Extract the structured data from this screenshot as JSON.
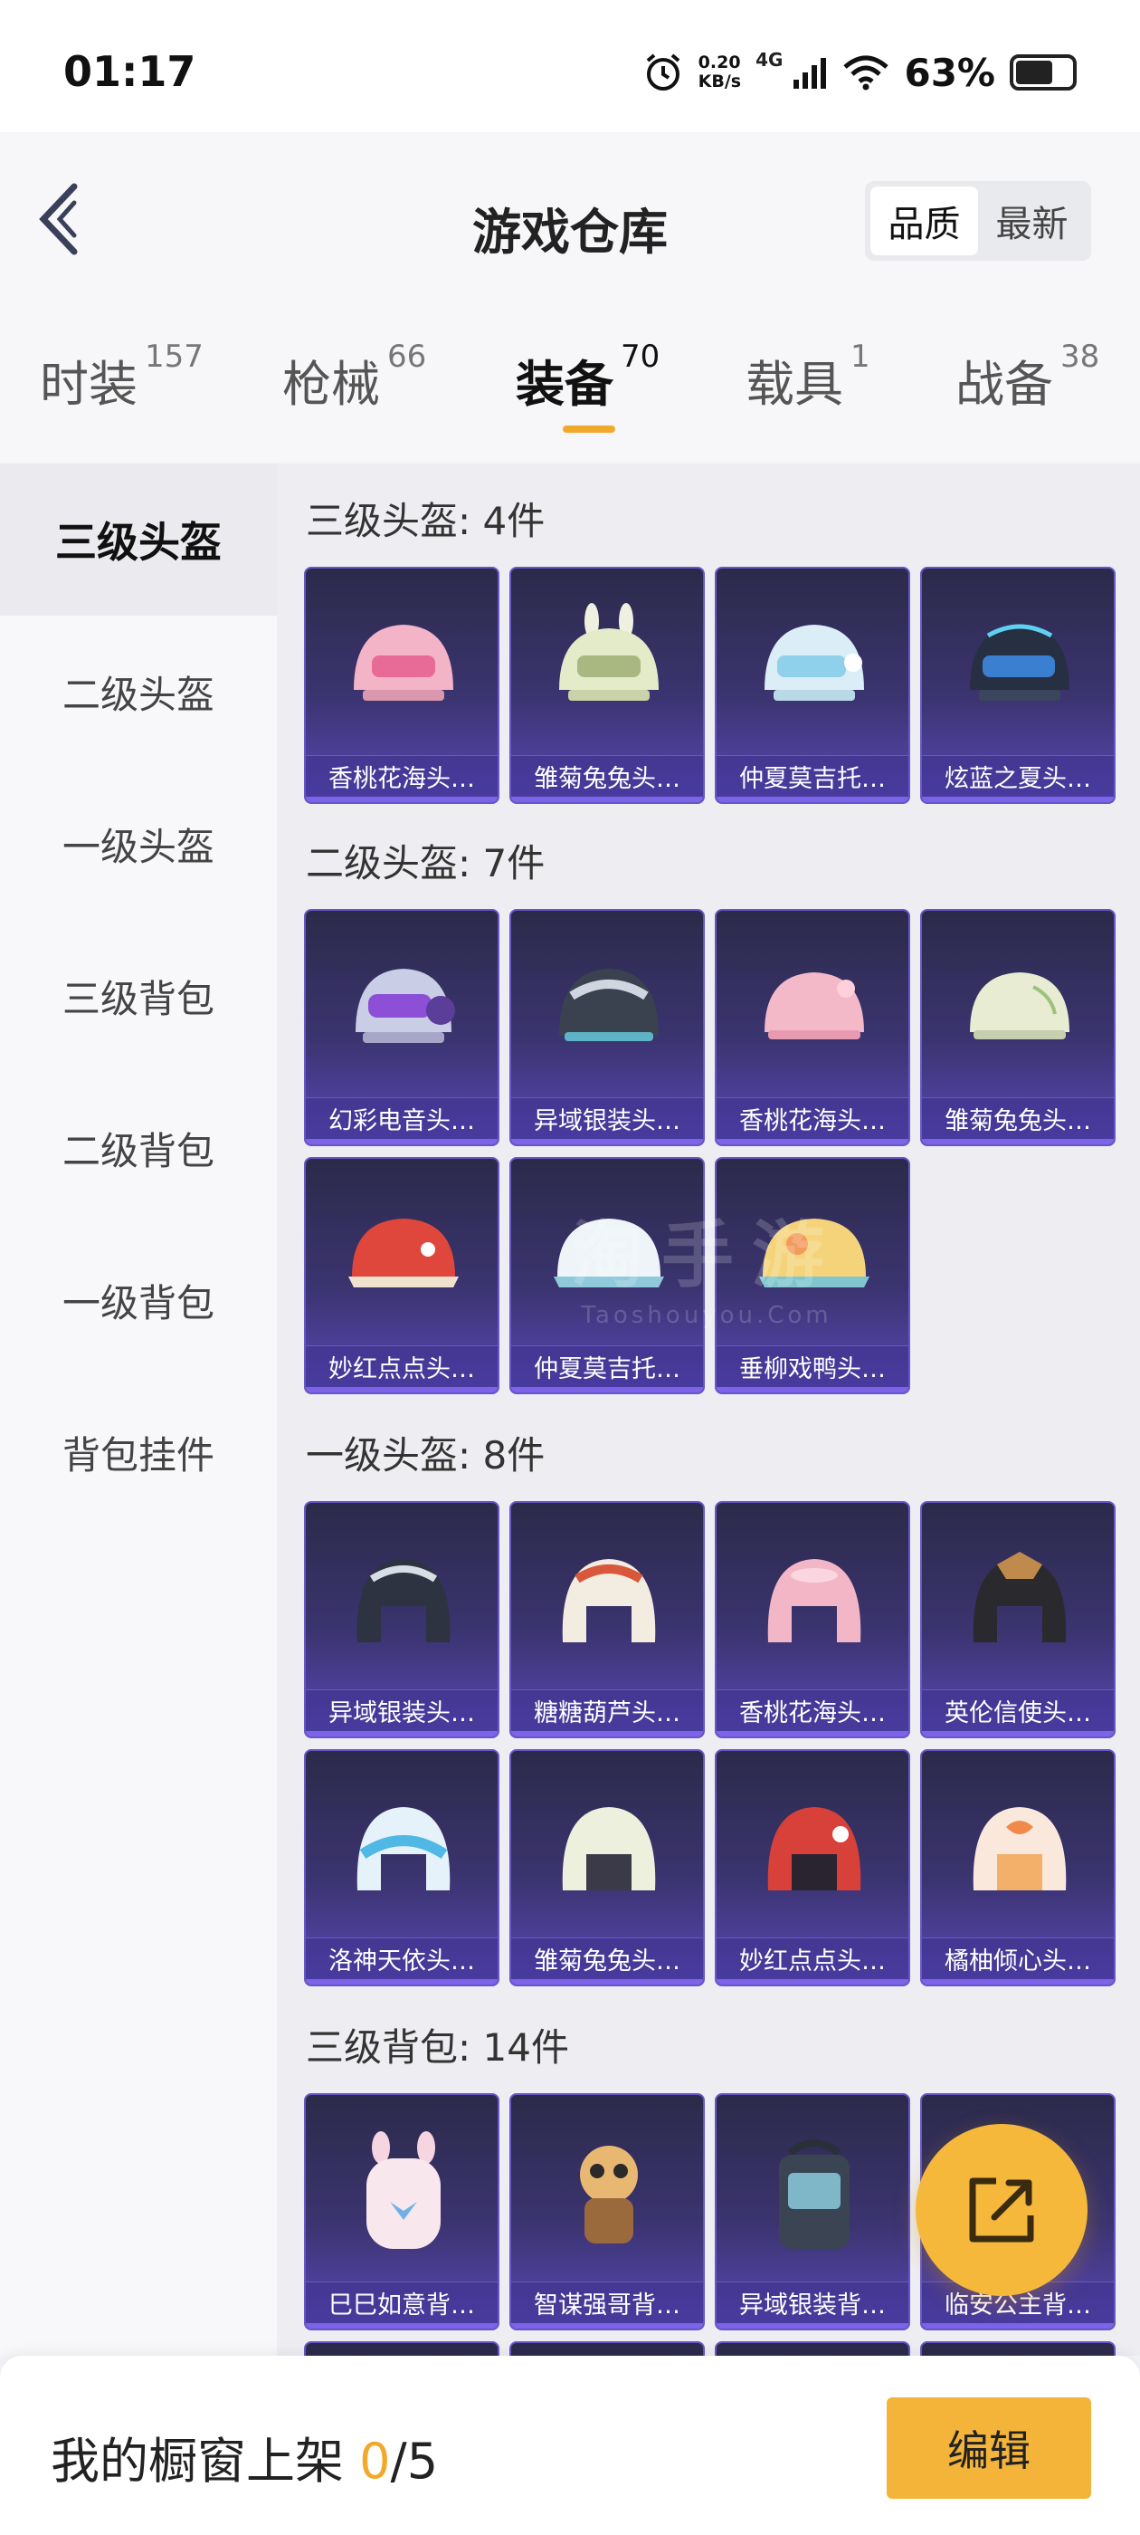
{
  "status_bar": {
    "time": "01:17",
    "net_speed_value": "0.20",
    "net_speed_unit": "KB/s",
    "network": "4G",
    "battery": "63%"
  },
  "header": {
    "title": "游戏仓库",
    "sort_options": [
      "品质",
      "最新"
    ]
  },
  "tabs": [
    {
      "label": "时装",
      "count": "157"
    },
    {
      "label": "枪械",
      "count": "66"
    },
    {
      "label": "装备",
      "count": "70"
    },
    {
      "label": "载具",
      "count": "1"
    },
    {
      "label": "战备",
      "count": "38"
    }
  ],
  "sidebar": {
    "items": [
      "三级头盔",
      "二级头盔",
      "一级头盔",
      "三级背包",
      "二级背包",
      "一级背包",
      "背包挂件"
    ]
  },
  "sections": [
    {
      "title": "三级头盔: 4件",
      "items": [
        "香桃花海头…",
        "雏菊兔兔头…",
        "仲夏莫吉托…",
        "炫蓝之夏头…"
      ]
    },
    {
      "title": "二级头盔: 7件",
      "items": [
        "幻彩电音头…",
        "异域银装头…",
        "香桃花海头…",
        "雏菊兔兔头…",
        "妙红点点头…",
        "仲夏莫吉托…",
        "垂柳戏鸭头…"
      ]
    },
    {
      "title": "一级头盔: 8件",
      "items": [
        "异域银装头…",
        "糖糖葫芦头…",
        "香桃花海头…",
        "英伦信使头…",
        "洛神天依头…",
        "雏菊兔兔头…",
        "妙红点点头…",
        "橘柚倾心头…"
      ]
    },
    {
      "title": "三级背包: 14件",
      "items": [
        "巳巳如意背…",
        "智谋强哥背…",
        "异域银装背…",
        "临安公主背…"
      ]
    }
  ],
  "watermark": {
    "cn": "淘手游",
    "en": "Taoshouyou.Com"
  },
  "bottom_bar": {
    "showcase_label": "我的橱窗上架",
    "showcase_count": "0",
    "showcase_total": "/5",
    "edit_label": "编辑"
  },
  "colors": {
    "accent": "#f2a82a",
    "card_top": "#2c2a4a",
    "card_bottom": "#5a48b8"
  },
  "icons": [
    "alarm-icon",
    "signal-icon",
    "wifi-icon",
    "battery-icon",
    "back-icon",
    "share-icon"
  ]
}
